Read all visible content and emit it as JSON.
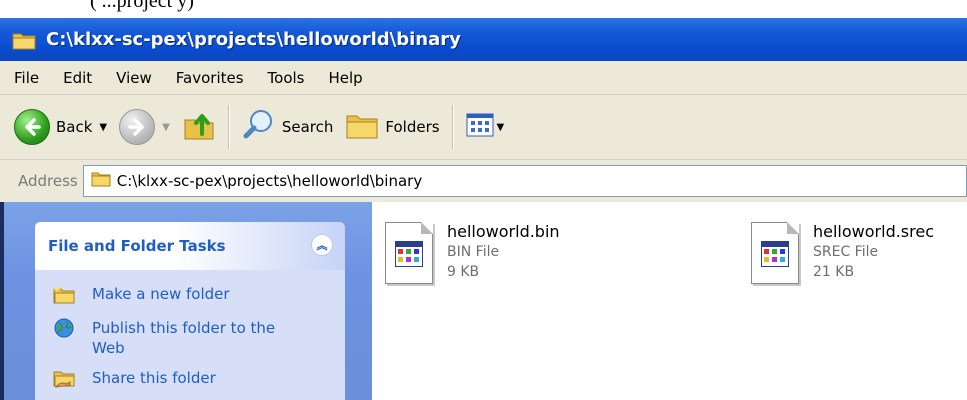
{
  "cropped_top_text": "(                            ...project                                            y)",
  "window": {
    "title": "C:\\klxx-sc-pex\\projects\\helloworld\\binary"
  },
  "menu": {
    "items": [
      {
        "label": "File"
      },
      {
        "label": "Edit"
      },
      {
        "label": "View"
      },
      {
        "label": "Favorites"
      },
      {
        "label": "Tools"
      },
      {
        "label": "Help"
      }
    ]
  },
  "toolbar": {
    "back_label": "Back",
    "search_label": "Search",
    "folders_label": "Folders"
  },
  "address": {
    "label": "Address",
    "value": "C:\\klxx-sc-pex\\projects\\helloworld\\binary"
  },
  "task_pane": {
    "header": "File and Folder Tasks",
    "tasks": [
      {
        "label": "Make a new folder"
      },
      {
        "label": "Publish this folder to the Web"
      },
      {
        "label": "Share this folder"
      }
    ]
  },
  "files": [
    {
      "name": "helloworld.bin",
      "type": "BIN File",
      "size": "9 KB"
    },
    {
      "name": "helloworld.srec",
      "type": "SREC File",
      "size": "21 KB"
    }
  ],
  "colors": {
    "titlebar": "#0a4ccf",
    "chrome": "#ece9d8",
    "task_pane_bg": "#6c92e1",
    "task_header_text": "#215dc6"
  }
}
